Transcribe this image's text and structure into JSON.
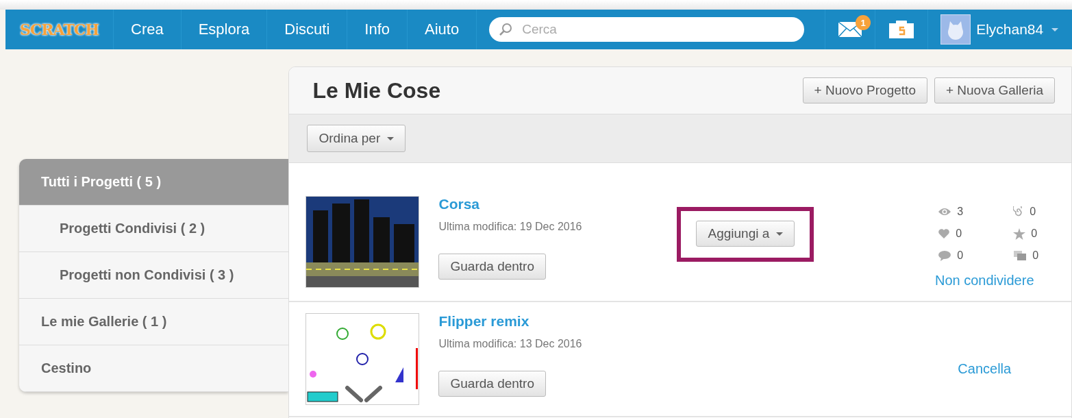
{
  "nav": {
    "logo": "SCRATCH",
    "links": [
      "Crea",
      "Esplora",
      "Discuti",
      "Info",
      "Aiuto"
    ],
    "search": {
      "placeholder": "Cerca"
    },
    "messages_badge": "1",
    "username": "Elychan84"
  },
  "sidebar": {
    "items": [
      {
        "label": "Tutti i Progetti ( 5 )",
        "selected": true,
        "children": [
          {
            "label": "Progetti Condivisi ( 2 )",
            "selected": false
          },
          {
            "label": "Progetti non Condivisi ( 3 )",
            "selected": false
          }
        ]
      },
      {
        "label": "Le mie Gallerie ( 1 )",
        "selected": false
      },
      {
        "label": "Cestino",
        "selected": false
      }
    ]
  },
  "main": {
    "title": "Le Mie Cose",
    "buttons": [
      "+ Nuovo Progetto",
      "+ Nuova Galleria"
    ],
    "sort_button": "Ordina per",
    "projects": [
      {
        "title": "Corsa",
        "modified": "Ultima modifica: 19 Dec 2016",
        "see_inside": "Guarda dentro",
        "add_to": {
          "label": "Aggiungi a",
          "highlighted": true
        },
        "stats": [
          {
            "kind": "views",
            "value": "3"
          },
          {
            "kind": "remixes",
            "value": "0"
          },
          {
            "kind": "loves",
            "value": "0"
          },
          {
            "kind": "favorites",
            "value": "0"
          },
          {
            "kind": "comments",
            "value": "0"
          },
          {
            "kind": "studios",
            "value": "0"
          }
        ],
        "action": "Non condividere",
        "kind": "city"
      },
      {
        "title": "Flipper remix",
        "modified": "Ultima modifica: 13 Dec 2016",
        "see_inside": "Guarda dentro",
        "action": "Cancella",
        "kind": "pinball"
      }
    ]
  }
}
